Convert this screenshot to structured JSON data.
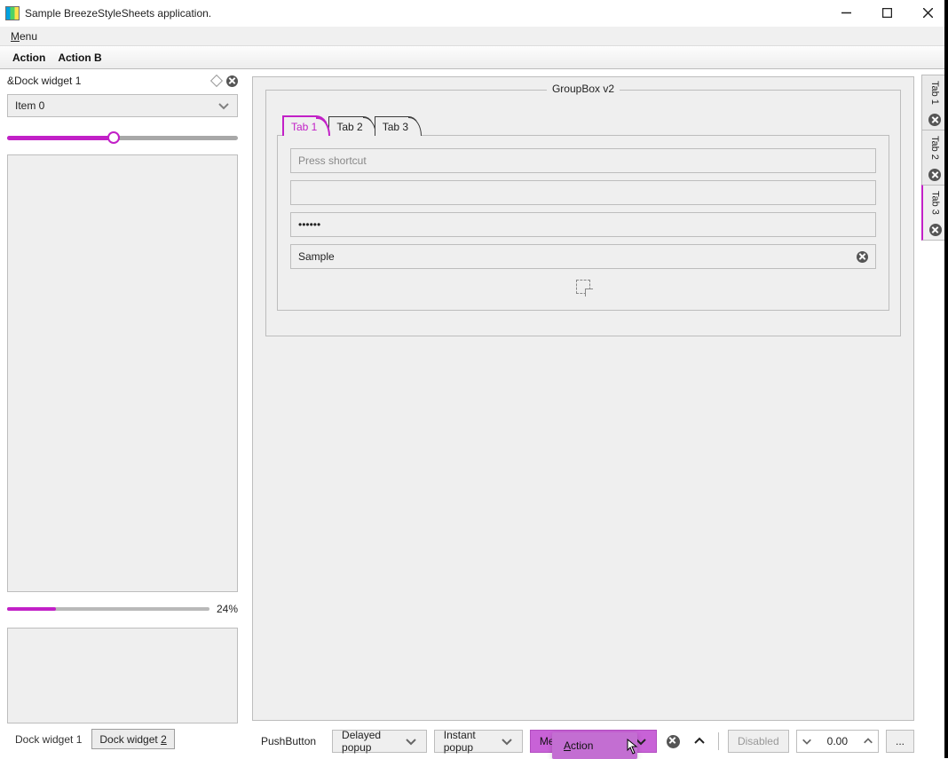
{
  "window": {
    "title": "Sample BreezeStyleSheets application."
  },
  "menubar": {
    "menu": "Menu",
    "menu_hotkey_char": "M"
  },
  "toolbar": {
    "action": "Action",
    "action_b": "Action B"
  },
  "dock": {
    "title": "&Dock widget 1",
    "combo_value": "Item 0",
    "progress_pct": "24%",
    "bottom_tabs": {
      "tab1": "Dock widget 1",
      "tab2_prefix": "Dock widget ",
      "tab2_hotkey_char": "2"
    }
  },
  "groupbox": {
    "title": "GroupBox v2",
    "tabs": {
      "t1": "Tab 1",
      "t2": "Tab 2",
      "t3": "Tab 3"
    },
    "inputs": {
      "shortcut_placeholder": "Press shortcut",
      "password_mask": "••••••",
      "sample_value": "Sample"
    }
  },
  "side_tabs": {
    "t1": "Tab 1",
    "t2": "Tab 2",
    "t3": "Tab 3"
  },
  "buttons": {
    "push": "PushButton",
    "delayed": "Delayed popup",
    "instant": "Instant popup",
    "menu_popup": "MenuButtonPopup",
    "disabled": "Disabled",
    "spin": "0.00",
    "more": "..."
  },
  "popup": {
    "action_prefix": "A",
    "action_rest": "ction"
  }
}
